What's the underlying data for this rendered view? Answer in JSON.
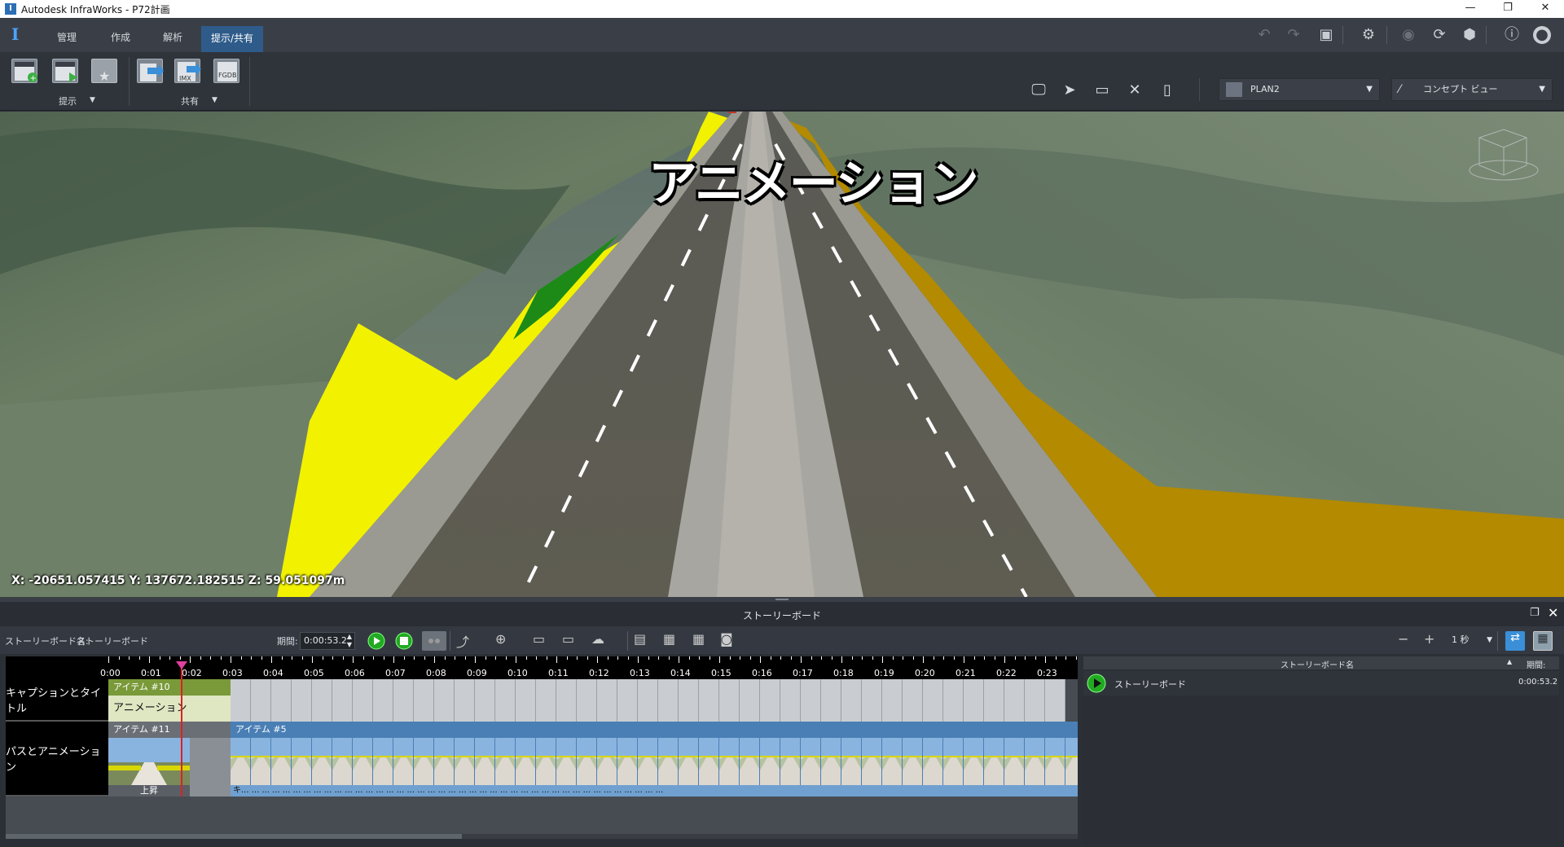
{
  "titlebar": {
    "title": "Autodesk InfraWorks - P72計画",
    "app_icon_glyph": "I",
    "minimize": "—",
    "restore": "❐",
    "close": "✕"
  },
  "menubar": {
    "logo": "I",
    "tabs": [
      {
        "label": "管理",
        "active": false
      },
      {
        "label": "作成",
        "active": false
      },
      {
        "label": "解析",
        "active": false
      },
      {
        "label": "提示/共有",
        "active": true
      }
    ],
    "right_icons": [
      "undo-icon",
      "redo-icon",
      "fit-screen-icon",
      "settings-icon",
      "globe-icon",
      "sync-icon",
      "cloud-icon",
      "help-icon",
      "user-icon"
    ]
  },
  "ribbon": {
    "present_group_label": "提示",
    "share_group_label": "共有",
    "present_buttons": [
      "new-storyboard-icon",
      "play-storyboard-icon",
      "favorite-icon"
    ],
    "share_buttons": [
      "export-icon",
      "imx-icon",
      "fgdb-icon"
    ],
    "imx_text": "IMX",
    "fgdb_text": "FGDB",
    "tools": [
      "display-tool-icon",
      "select-tool-icon",
      "measure-tool-icon",
      "cross-section-tool-icon",
      "panel-tool-icon"
    ],
    "plan_select": "PLAN2",
    "view_select": "コンセプト ビュー"
  },
  "viewport": {
    "caption": "アニメーション",
    "coordinates": "X: -20651.057415 Y: 137672.182515 Z: 59.051097m"
  },
  "storyboard": {
    "panel_title": "ストーリーボード",
    "name_label": "ストーリーボード名:",
    "name_value": "ストーリーボード",
    "duration_label": "期間:",
    "duration_value": "0:00:53.2",
    "interval_value": "1 秒",
    "ruler_ticks": [
      "0:00",
      "0:01",
      "0:02",
      "0:03",
      "0:04",
      "0:05",
      "0:06",
      "0:07",
      "0:08",
      "0:09",
      "0:10",
      "0:11",
      "0:12",
      "0:13",
      "0:14",
      "0:15",
      "0:16",
      "0:17",
      "0:18",
      "0:19",
      "0:20",
      "0:21",
      "0:22",
      "0:23"
    ],
    "tracks": {
      "captions_label": "キャプションとタイトル",
      "caption_item_title": "アイテム #10",
      "caption_item_text": "アニメーション",
      "path_label": "パスとアニメーション",
      "path_item11_title": "アイテム #11",
      "path_item11_footer": "上昇",
      "path_item5_title": "アイテム #5",
      "path_item5_footer_first": "キ...",
      "path_item5_footer_rest": "..."
    },
    "list": {
      "col_name": "ストーリーボード名",
      "col_duration": "期間:",
      "row_name": "ストーリーボード",
      "row_duration": "0:00:53.2"
    }
  },
  "colors": {
    "accent_blue": "#2e5b8a",
    "playhead_red": "#e02020",
    "caption_green": "#7a9a3a",
    "slope_yellow": "#f2f200",
    "slope_ochre": "#b08a00"
  }
}
